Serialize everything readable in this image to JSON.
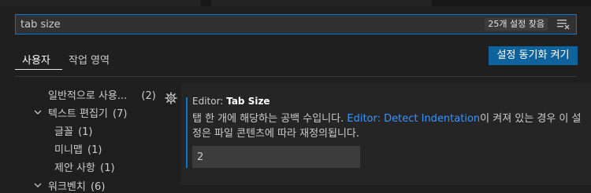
{
  "search": {
    "value": "tab size",
    "result_count": "25개 설정 찾음",
    "filter_icon": "filter-clear-icon"
  },
  "tabs": [
    {
      "label": "사용자",
      "active": true
    },
    {
      "label": "작업 영역",
      "active": false
    }
  ],
  "sync_button": {
    "label": "설정 동기화 켜기"
  },
  "toc": {
    "items": [
      {
        "label": "일반적으로 사용...",
        "count": "(2)",
        "expanded": null
      },
      {
        "label": "텍스트 편집기",
        "count": "(7)",
        "expanded": true
      },
      {
        "label": "글꼴",
        "count": "(1)",
        "expanded": null
      },
      {
        "label": "미니맵",
        "count": "(1)",
        "expanded": null
      },
      {
        "label": "제안 사항",
        "count": "(1)",
        "expanded": null
      },
      {
        "label": "워크벤치",
        "count": "(6)",
        "expanded": true
      }
    ]
  },
  "setting": {
    "category": "Editor:",
    "name": "Tab Size",
    "desc_before": "탭 한 개에 해당하는 공백 수입니다. ",
    "desc_link": "Editor: Detect Indentation",
    "desc_after": "이 켜져 있는 경우 이 설정은 파일 콘텐츠에 따라 재정의됩니다.",
    "value": "2",
    "gear_icon": "gear-icon"
  },
  "colors": {
    "background": "#1f1f1f",
    "panel": "#252526",
    "accent": "#0078d4",
    "button": "#0e639c",
    "link": "#3794ff"
  }
}
